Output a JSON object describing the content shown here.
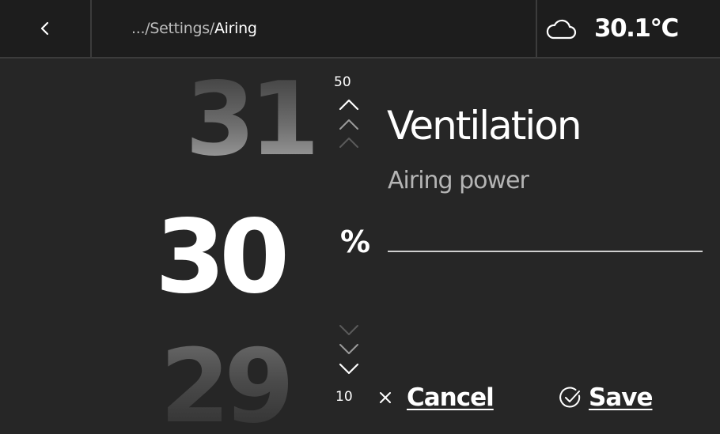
{
  "header": {
    "breadcrumb_path": ".../Settings/",
    "breadcrumb_current": "Airing"
  },
  "weather": {
    "icon": "cloud-icon",
    "temperature": "30.1°C"
  },
  "picker": {
    "previous_value": "31",
    "current_value": "30",
    "next_value": "29",
    "max_label": "50",
    "min_label": "10",
    "unit": "%"
  },
  "setting": {
    "title": "Ventilation",
    "subtitle": "Airing power"
  },
  "actions": {
    "cancel_label": "Cancel",
    "save_label": "Save"
  },
  "colors": {
    "background": "#262626",
    "topbar": "#1d1d1d",
    "text": "#ffffff",
    "muted_text": "#b5b5b5"
  }
}
